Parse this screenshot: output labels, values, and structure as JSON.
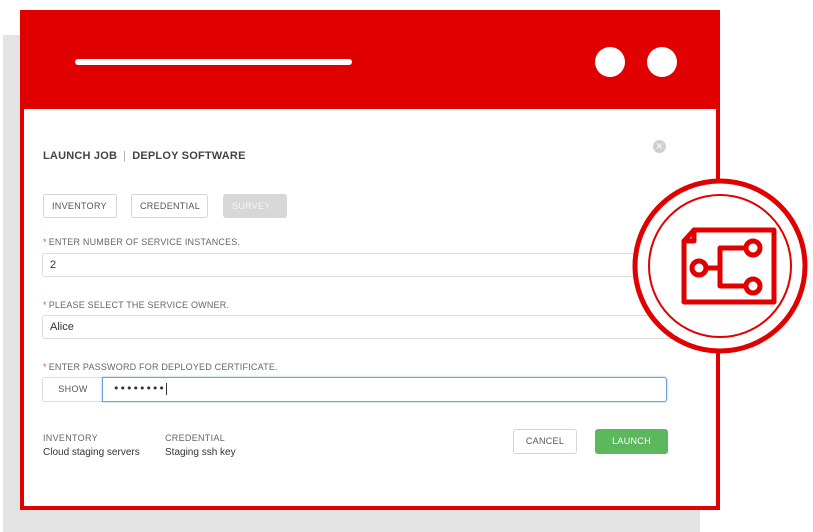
{
  "dialog": {
    "title_left": "LAUNCH JOB",
    "title_sep": "|",
    "title_right": "DEPLOY SOFTWARE",
    "close_glyph": "×"
  },
  "tabs": [
    {
      "label": "INVENTORY",
      "state": "default"
    },
    {
      "label": "CREDENTIAL",
      "state": "default"
    },
    {
      "label": "SURVEY",
      "state": "disabled"
    }
  ],
  "fields": [
    {
      "required_mark": "*",
      "label": "ENTER NUMBER OF SERVICE INSTANCES.",
      "value": "2"
    },
    {
      "required_mark": "*",
      "label": "PLEASE SELECT THE SERVICE OWNER.",
      "value": "Alice"
    },
    {
      "required_mark": "*",
      "label": "ENTER PASSWORD FOR DEPLOYED CERTIFICATE.",
      "value": "••••••••"
    }
  ],
  "password_toggle_label": "SHOW",
  "summary": {
    "inventory_label": "INVENTORY",
    "inventory_value": "Cloud staging servers",
    "credential_label": "CREDENTIAL",
    "credential_value": "Staging ssh key"
  },
  "actions": {
    "cancel_label": "CANCEL",
    "launch_label": "LAUNCH"
  },
  "colors": {
    "brand_red": "#e00000",
    "launch_green": "#5cb85c",
    "required_red": "#d9534f",
    "focus_blue": "#6ea3d8"
  },
  "icons": {
    "badge": "workflow-document-icon",
    "close": "close-icon"
  }
}
